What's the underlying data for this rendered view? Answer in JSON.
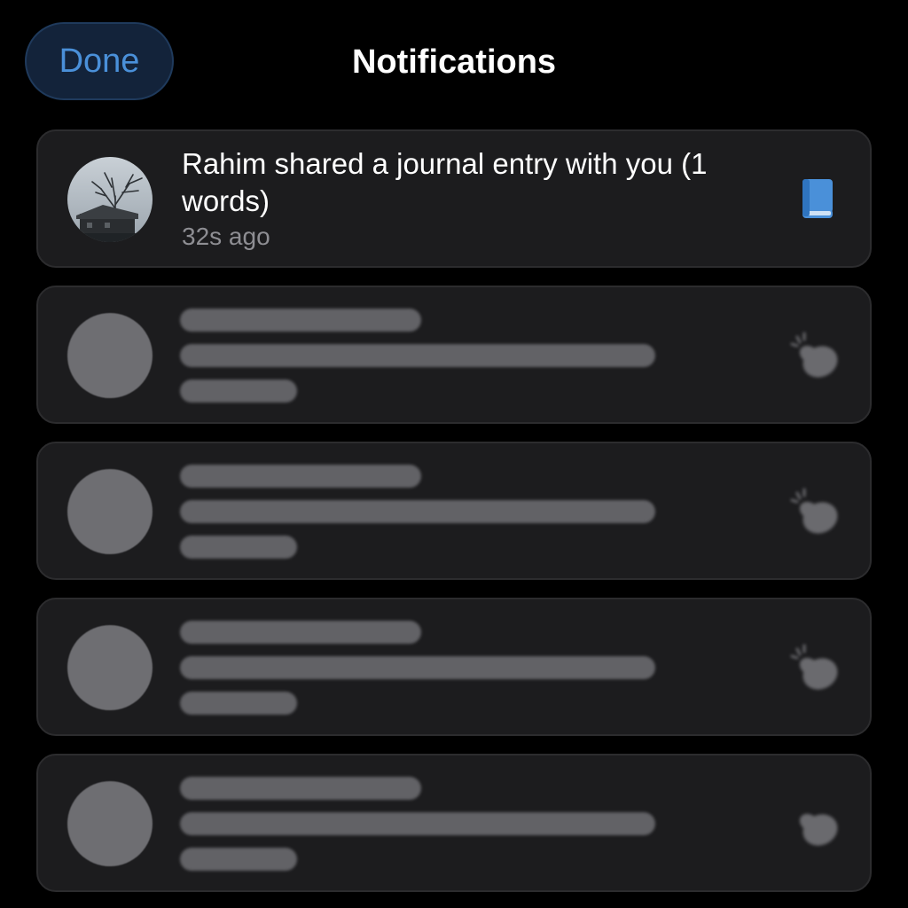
{
  "header": {
    "done_label": "Done",
    "title": "Notifications"
  },
  "notifications": [
    {
      "message": "Rahim shared a journal entry with you (1 words)",
      "time": "32s ago",
      "icon": "book-icon",
      "avatar": "landscape-photo-avatar"
    }
  ],
  "placeholders": {
    "count": 4,
    "icon": "clap-icon"
  },
  "colors": {
    "background": "#000000",
    "card": "#1c1c1e",
    "card_border": "#2c2c2e",
    "accent": "#4a90d9",
    "done_bg": "#13233a",
    "secondary_text": "#8e8e93",
    "skeleton": "#626266"
  }
}
